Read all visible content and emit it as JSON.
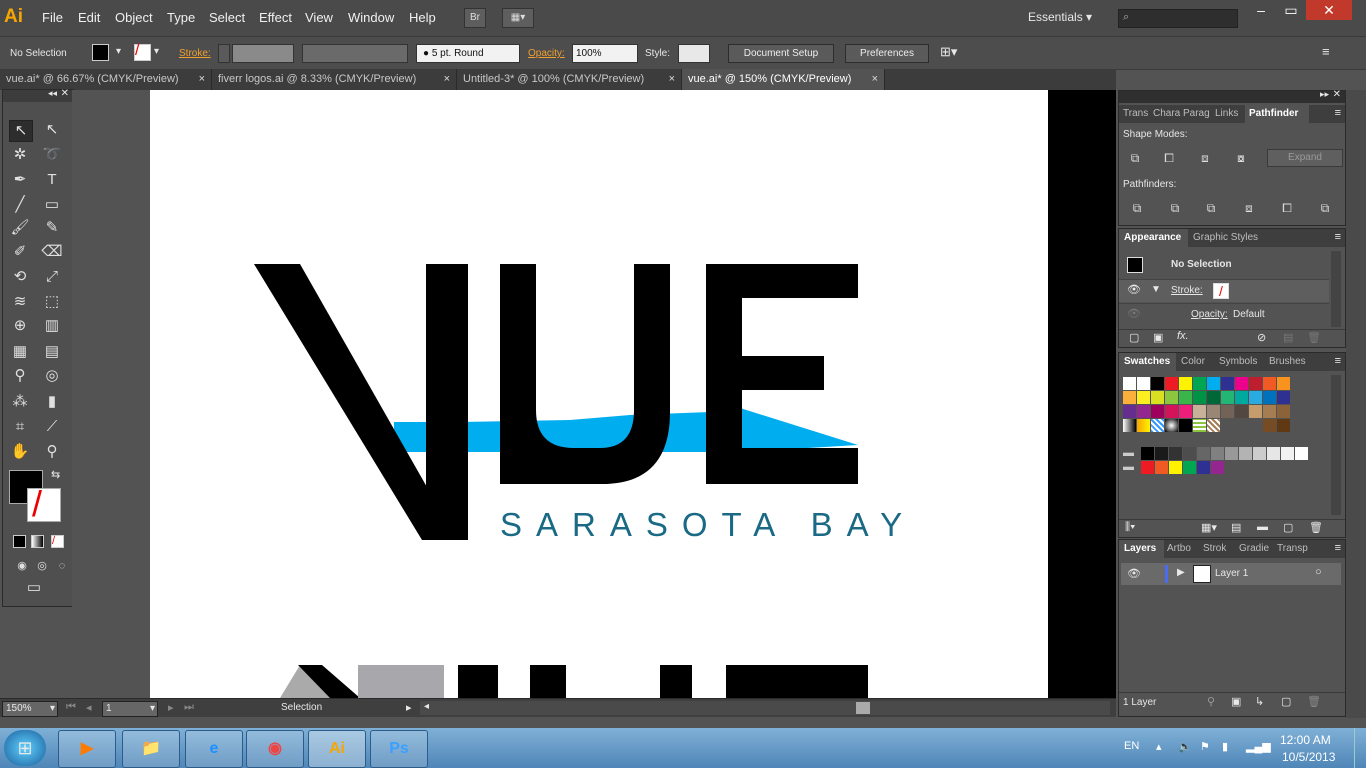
{
  "app": {
    "logo": "Ai"
  },
  "menus": [
    "File",
    "Edit",
    "Object",
    "Type",
    "Select",
    "Effect",
    "View",
    "Window",
    "Help"
  ],
  "menubar": {
    "bridge_label": "Br",
    "workspace": "Essentials"
  },
  "control_bar": {
    "selection": "No Selection",
    "stroke_label": "Stroke:",
    "brush": "5 pt. Round",
    "opacity_label": "Opacity:",
    "opacity_value": "100%",
    "style_label": "Style:",
    "document_setup": "Document Setup",
    "preferences": "Preferences"
  },
  "tabs": [
    {
      "label": "vue.ai* @ 66.67% (CMYK/Preview)",
      "active": false
    },
    {
      "label": "fiverr logos.ai @ 8.33% (CMYK/Preview)",
      "active": false
    },
    {
      "label": "Untitled-3* @ 100% (CMYK/Preview)",
      "active": false
    },
    {
      "label": "vue.ai* @ 150% (CMYK/Preview)",
      "active": true
    }
  ],
  "tab_close": "×",
  "artwork": {
    "tagline": "SARASOTA BAY"
  },
  "status": {
    "zoom": "150%",
    "page": "1",
    "tool": "Selection"
  },
  "pathfinder_panel": {
    "tabs": [
      "Trans",
      "Chara",
      "Parag",
      "Links",
      "Pathfinder"
    ],
    "shape_modes": "Shape Modes:",
    "expand": "Expand",
    "pathfinders": "Pathfinders:"
  },
  "appearance_panel": {
    "tabs": [
      "Appearance",
      "Graphic Styles"
    ],
    "no_selection": "No Selection",
    "stroke_label": "Stroke:",
    "opacity_label": "Opacity:",
    "opacity_value": "Default"
  },
  "swatches_panel": {
    "tabs": [
      "Swatches",
      "Color",
      "Symbols",
      "Brushes"
    ],
    "row1": [
      "#ffffff",
      "#ffffff",
      "#000000",
      "#ed1c24",
      "#fff200",
      "#00a651",
      "#00aeef",
      "#2e3192",
      "#ec008c",
      "#be1e2d",
      "#f15a24",
      "#f7931e"
    ],
    "row2": [
      "#fbb03b",
      "#fcee21",
      "#d9e021",
      "#8cc63f",
      "#39b54a",
      "#009245",
      "#006837",
      "#22b573",
      "#00a99d",
      "#29abe2",
      "#0071bc",
      "#2e3192"
    ],
    "row3": [
      "#662d91",
      "#93278f",
      "#9e005d",
      "#d4145a",
      "#ed1e79",
      "#c7b299",
      "#998675",
      "#736357",
      "#534741",
      "#c69c6d",
      "#a67c52",
      "#8c6239"
    ],
    "row4_tail": [
      "#754c24",
      "#603813"
    ],
    "grays": [
      "#000000",
      "#1a1a1a",
      "#333333",
      "#4d4d4d",
      "#666666",
      "#808080",
      "#999999",
      "#b3b3b3",
      "#cccccc",
      "#e6e6e6",
      "#f2f2f2",
      "#ffffff"
    ],
    "group": [
      "#ed1c24",
      "#f15a24",
      "#fff200",
      "#00a651",
      "#2e3192",
      "#93278f"
    ]
  },
  "layers_panel": {
    "tabs": [
      "Layers",
      "Artbo",
      "Strok",
      "Gradie",
      "Transp"
    ],
    "layer_name": "Layer 1",
    "footer": "1 Layer"
  },
  "taskbar": {
    "apps": [
      "Media",
      "Explorer",
      "IE",
      "Chrome",
      "Ai",
      "Ps"
    ],
    "lang": "EN",
    "time": "12:00 AM",
    "date": "10/5/2013"
  },
  "colors": {
    "accent": "#f7a600",
    "water": "#00aeef",
    "tagline": "#1b6a85"
  }
}
